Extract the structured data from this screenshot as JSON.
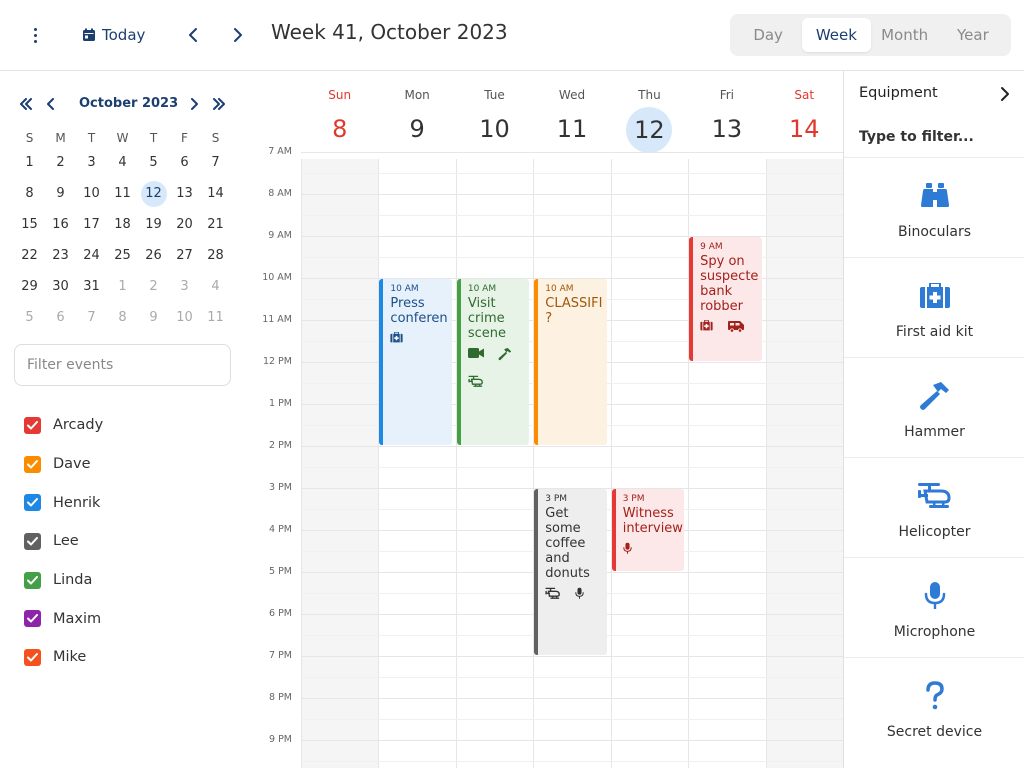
{
  "toolbar": {
    "today_label": "Today",
    "week_title": "Week 41, October 2023",
    "views": [
      {
        "label": "Day",
        "active": false
      },
      {
        "label": "Week",
        "active": true
      },
      {
        "label": "Month",
        "active": false
      },
      {
        "label": "Year",
        "active": false
      }
    ]
  },
  "mini_calendar": {
    "month_label": "October 2023",
    "weekday_labels": [
      "S",
      "M",
      "T",
      "W",
      "T",
      "F",
      "S"
    ],
    "weeks": [
      [
        {
          "d": "1"
        },
        {
          "d": "2"
        },
        {
          "d": "3"
        },
        {
          "d": "4"
        },
        {
          "d": "5"
        },
        {
          "d": "6"
        },
        {
          "d": "7"
        }
      ],
      [
        {
          "d": "8"
        },
        {
          "d": "9"
        },
        {
          "d": "10"
        },
        {
          "d": "11"
        },
        {
          "d": "12",
          "today": true
        },
        {
          "d": "13"
        },
        {
          "d": "14"
        }
      ],
      [
        {
          "d": "15"
        },
        {
          "d": "16"
        },
        {
          "d": "17"
        },
        {
          "d": "18"
        },
        {
          "d": "19"
        },
        {
          "d": "20"
        },
        {
          "d": "21"
        }
      ],
      [
        {
          "d": "22"
        },
        {
          "d": "23"
        },
        {
          "d": "24"
        },
        {
          "d": "25"
        },
        {
          "d": "26"
        },
        {
          "d": "27"
        },
        {
          "d": "28"
        }
      ],
      [
        {
          "d": "29"
        },
        {
          "d": "30"
        },
        {
          "d": "31"
        },
        {
          "d": "1",
          "other": true
        },
        {
          "d": "2",
          "other": true
        },
        {
          "d": "3",
          "other": true
        },
        {
          "d": "4",
          "other": true
        }
      ],
      [
        {
          "d": "5",
          "other": true
        },
        {
          "d": "6",
          "other": true
        },
        {
          "d": "7",
          "other": true
        },
        {
          "d": "8",
          "other": true
        },
        {
          "d": "9",
          "other": true
        },
        {
          "d": "10",
          "other": true
        },
        {
          "d": "11",
          "other": true
        }
      ]
    ]
  },
  "filter": {
    "placeholder": "Filter events"
  },
  "people": [
    {
      "name": "Arcady",
      "color": "#e53935"
    },
    {
      "name": "Dave",
      "color": "#fb8c00"
    },
    {
      "name": "Henrik",
      "color": "#1e88e5"
    },
    {
      "name": "Lee",
      "color": "#616161"
    },
    {
      "name": "Linda",
      "color": "#43a047"
    },
    {
      "name": "Maxim",
      "color": "#8e24aa"
    },
    {
      "name": "Mike",
      "color": "#f4511e"
    }
  ],
  "days": [
    {
      "name": "Sun",
      "num": "8",
      "weekend": true
    },
    {
      "name": "Mon",
      "num": "9"
    },
    {
      "name": "Tue",
      "num": "10"
    },
    {
      "name": "Wed",
      "num": "11"
    },
    {
      "name": "Thu",
      "num": "12",
      "today": true
    },
    {
      "name": "Fri",
      "num": "13"
    },
    {
      "name": "Sat",
      "num": "14",
      "weekend": true
    }
  ],
  "time_labels": [
    "7 AM",
    "8 AM",
    "9 AM",
    "10 AM",
    "11 AM",
    "12 PM",
    "1 PM",
    "2 PM",
    "3 PM",
    "4 PM",
    "5 PM",
    "6 PM",
    "7 PM",
    "8 PM",
    "9 PM"
  ],
  "events": [
    {
      "day": 1,
      "start": 10,
      "end": 14,
      "time": "10 AM",
      "title": "Press\nconferen",
      "bg": "#e7f1fc",
      "border": "#1e88e5",
      "fg": "#1c4f8a",
      "icons": [
        "first-aid-kit"
      ]
    },
    {
      "day": 2,
      "start": 10,
      "end": 14,
      "time": "10 AM",
      "title": "Visit\ncrime\nscene",
      "bg": "#e8f3e8",
      "border": "#43a047",
      "fg": "#2e6b2f",
      "icons": [
        "video-camera",
        "hammer",
        "helicopter"
      ]
    },
    {
      "day": 3,
      "start": 10,
      "end": 14,
      "time": "10 AM",
      "title": "CLASSIFI\n?",
      "bg": "#fdf1e2",
      "border": "#fb8c00",
      "fg": "#a0580a",
      "icons": []
    },
    {
      "day": 5,
      "start": 9,
      "end": 12,
      "time": "9 AM",
      "title": "Spy on\nsuspecte\nbank\nrobber",
      "bg": "#fce8e8",
      "border": "#e53935",
      "fg": "#a3211c",
      "icons": [
        "first-aid-kit",
        "van"
      ]
    },
    {
      "day": 3,
      "start": 15,
      "end": 19,
      "time": "3 PM",
      "title": "Get\nsome\ncoffee\nand\ndonuts",
      "bg": "#eeeeee",
      "border": "#616161",
      "fg": "#333333",
      "icons": [
        "helicopter",
        "microphone"
      ]
    },
    {
      "day": 4,
      "start": 15,
      "end": 17,
      "time": "3 PM",
      "title": "Witness\ninterview",
      "bg": "#fce8e8",
      "border": "#e53935",
      "fg": "#a3211c",
      "icons": [
        "microphone"
      ]
    }
  ],
  "equipment": {
    "header": "Equipment",
    "filter_placeholder": "Type to filter...",
    "items": [
      {
        "label": "Binoculars",
        "icon": "binoculars-icon"
      },
      {
        "label": "First aid kit",
        "icon": "first-aid-kit-icon"
      },
      {
        "label": "Hammer",
        "icon": "hammer-icon"
      },
      {
        "label": "Helicopter",
        "icon": "helicopter-icon"
      },
      {
        "label": "Microphone",
        "icon": "microphone-icon"
      },
      {
        "label": "Secret device",
        "icon": "question-icon"
      }
    ]
  },
  "accent_color": "#1c3f71",
  "icon_blue": "#2e7bd6"
}
